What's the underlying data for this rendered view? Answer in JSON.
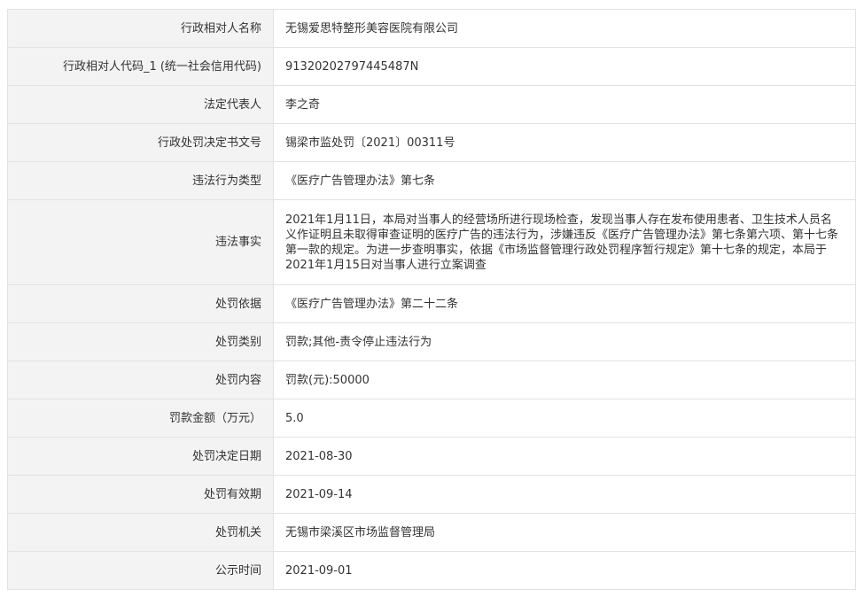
{
  "rows": [
    {
      "label": "行政相对人名称",
      "value": "无锡爱思特整形美容医院有限公司"
    },
    {
      "label": "行政相对人代码_1 (统一社会信用代码)",
      "value": "91320202797445487N"
    },
    {
      "label": "法定代表人",
      "value": "李之奇"
    },
    {
      "label": "行政处罚决定书文号",
      "value": "锡梁市监处罚〔2021〕00311号"
    },
    {
      "label": "违法行为类型",
      "value": "《医疗广告管理办法》第七条"
    },
    {
      "label": "违法事实",
      "value": "2021年1月11日，本局对当事人的经营场所进行现场检查，发现当事人存在发布使用患者、卫生技术人员名义作证明且未取得审查证明的医疗广告的违法行为，涉嫌违反《医疗广告管理办法》第七条第六项、第十七条第一款的规定。为进一步查明事实，依据《市场监督管理行政处罚程序暂行规定》第十七条的规定，本局于2021年1月15日对当事人进行立案调查"
    },
    {
      "label": "处罚依据",
      "value": "《医疗广告管理办法》第二十二条"
    },
    {
      "label": "处罚类别",
      "value": "罚款;其他-责令停止违法行为"
    },
    {
      "label": "处罚内容",
      "value": "罚款(元):50000"
    },
    {
      "label": "罚款金额（万元）",
      "value": "5.0"
    },
    {
      "label": "处罚决定日期",
      "value": "2021-08-30"
    },
    {
      "label": "处罚有效期",
      "value": "2021-09-14"
    },
    {
      "label": "处罚机关",
      "value": "无锡市梁溪区市场监督管理局"
    },
    {
      "label": "公示时间",
      "value": "2021-09-01"
    }
  ]
}
